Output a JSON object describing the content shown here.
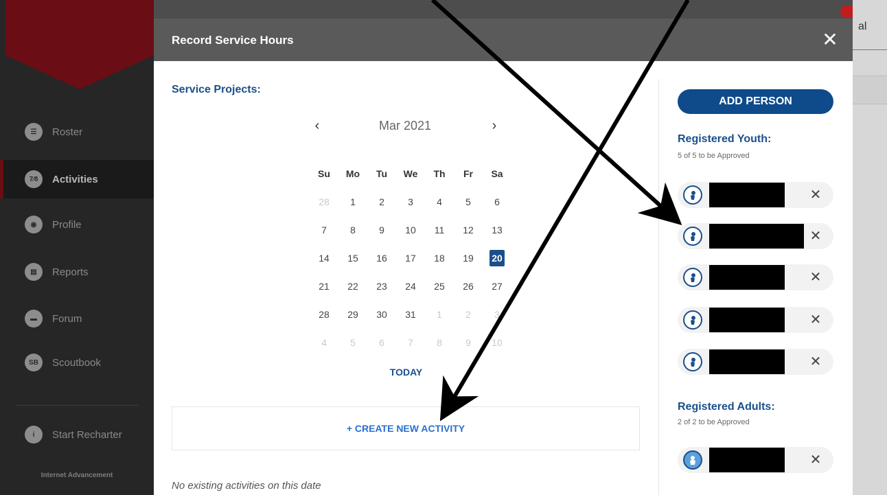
{
  "sidebar": {
    "items": [
      {
        "label": "Roster",
        "icon": "list-icon",
        "glyph": "☰"
      },
      {
        "label": "Activities",
        "icon": "activities-icon",
        "glyph": "7⁄8"
      },
      {
        "label": "Profile",
        "icon": "profile-icon",
        "glyph": "◉"
      },
      {
        "label": "Reports",
        "icon": "clipboard-icon",
        "glyph": "▤"
      },
      {
        "label": "Forum",
        "icon": "chat-icon",
        "glyph": "▬"
      },
      {
        "label": "Scoutbook",
        "icon": "scoutbook-icon",
        "glyph": "SB"
      }
    ],
    "recharter": {
      "label": "Start Recharter",
      "icon": "info-icon",
      "glyph": "i"
    },
    "footer": "Internet Advancement"
  },
  "background": {
    "right_fragment": "al"
  },
  "modal": {
    "title": "Record Service Hours",
    "close_glyph": "✕",
    "service_projects_label": "Service Projects:",
    "calendar": {
      "month_label": "Mar 2021",
      "prev_glyph": "‹",
      "next_glyph": "›",
      "weekdays": [
        "Su",
        "Mo",
        "Tu",
        "We",
        "Th",
        "Fr",
        "Sa"
      ],
      "days": [
        [
          "28",
          "1",
          "2",
          "3",
          "4",
          "5",
          "6"
        ],
        [
          "7",
          "8",
          "9",
          "10",
          "11",
          "12",
          "13"
        ],
        [
          "14",
          "15",
          "16",
          "17",
          "18",
          "19",
          "20"
        ],
        [
          "21",
          "22",
          "23",
          "24",
          "25",
          "26",
          "27"
        ],
        [
          "28",
          "29",
          "30",
          "31",
          "1",
          "2",
          "3"
        ],
        [
          "4",
          "5",
          "6",
          "7",
          "8",
          "9",
          "10"
        ]
      ],
      "selected_day": "20",
      "today_label": "TODAY"
    },
    "create_activity_label": "+ CREATE NEW ACTIVITY",
    "no_activities_text": "No existing activities on this date",
    "right_panel": {
      "add_person_label": "ADD PERSON",
      "youth": {
        "title": "Registered Youth:",
        "subtitle": "5 of 5 to be Approved",
        "count": 5
      },
      "adults": {
        "title": "Registered Adults:",
        "subtitle": "2 of 2 to be Approved",
        "visible_count": 1
      },
      "remove_glyph": "✕"
    }
  },
  "colors": {
    "accent_blue": "#1a4f8c",
    "button_blue": "#0f4a8a",
    "link_blue": "#2a6fd0",
    "header_gray": "#5a5a5a",
    "brand_red": "#6a0d14"
  }
}
